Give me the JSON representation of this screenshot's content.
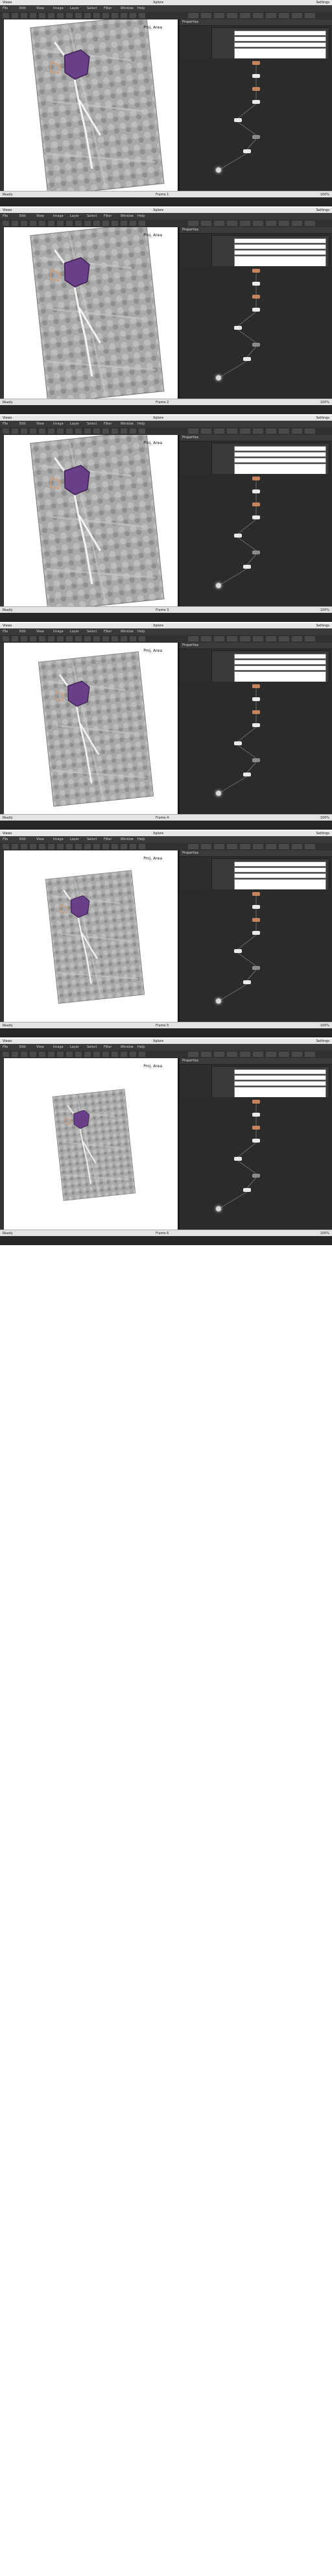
{
  "app": {
    "window_title": "Xplore",
    "left_title": "Views",
    "right_title": "Settings",
    "menu_items": [
      "File",
      "Edit",
      "View",
      "Image",
      "Layer",
      "Select",
      "Filter",
      "Window",
      "Help"
    ],
    "panel_header": "Properties",
    "status_left": "Ready",
    "status_center": "Frame",
    "status_right": "100%"
  },
  "frames": [
    {
      "label": "Frame 1",
      "rotation_deg": -6,
      "scale": 1.0,
      "offset_x": 0
    },
    {
      "label": "Frame 2",
      "rotation_deg": -6,
      "scale": 1.0,
      "offset_x": 0
    },
    {
      "label": "Frame 3",
      "rotation_deg": -6,
      "scale": 1.0,
      "offset_x": 0
    },
    {
      "label": "Frame 4",
      "rotation_deg": -6,
      "scale": 0.86,
      "offset_x": 0
    },
    {
      "label": "Frame 5",
      "rotation_deg": -6,
      "scale": 0.74,
      "offset_x": 0
    },
    {
      "label": "Frame 6",
      "rotation_deg": -6,
      "scale": 0.62,
      "offset_x": 0
    }
  ],
  "viewer": {
    "map_label": "Proj. Area",
    "accent": "#6a3f8a",
    "terrain": "#a9a9a9"
  },
  "colors": {
    "node_orange": "#c8825a",
    "node_white": "#e9e9e9",
    "node_gray": "#8a8a8a",
    "edge": "#6a6a6a",
    "panel_bg": "#2e2e2e"
  }
}
